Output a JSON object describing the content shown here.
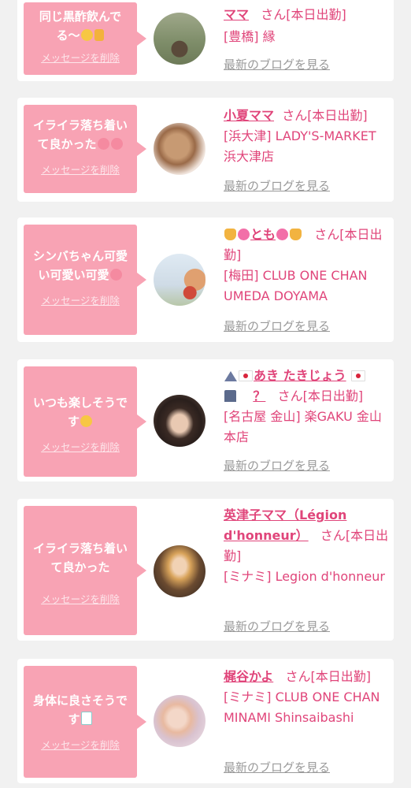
{
  "delete_label": "メッセージを削除",
  "blog_label": "最新のブログを見る",
  "san_label": "さん[本日出勤]",
  "cards": [
    {
      "message": "同じ黒酢飲んでる〜",
      "message_icons": [
        "grinning-sweat-icon",
        "thumbs-up-icon"
      ],
      "name": "ママ",
      "shop": "[豊橋] 縁"
    },
    {
      "message": "イライラ落ち着いて良かった",
      "message_icons": [
        "smiling-hearts-icon",
        "heart-eyes-icon"
      ],
      "name": "小夏ママ",
      "shop": "[浜大津] LADY'S-MARKET 浜大津店"
    },
    {
      "message": "シンバちゃん可愛い可愛い可愛",
      "message_icons": [
        "heart-eyes-icon"
      ],
      "name": "とも",
      "name_icons": [
        "cat-icon",
        "pink-heart-icon",
        "pink-heart-icon",
        "cat-icon"
      ],
      "shop": "[梅田] CLUB ONE CHAN UMEDA DOYAMA"
    },
    {
      "message": "いつも楽しそうです",
      "message_icons": [
        "smiling-face-icon"
      ],
      "name": "あき たきじょう",
      "name_icons": [
        "mountain-icon",
        "japan-flag-icon",
        "japan-flag-icon",
        "castle-icon"
      ],
      "name_suffix": "？",
      "shop": "[名古屋 金山] 楽GAKU 金山本店"
    },
    {
      "message": "イライラ落ち着いて良かった",
      "message_icons": [],
      "name": "英津子ママ（Légion d'honneur）",
      "shop": "[ミナミ] Legion d'honneur"
    },
    {
      "message": "身体に良さそうです",
      "message_icons": [
        "mahjong-tile-icon"
      ],
      "name": "梶谷かよ",
      "shop": "[ミナミ] CLUB ONE CHAN MINAMI Shinsaibashi"
    }
  ]
}
